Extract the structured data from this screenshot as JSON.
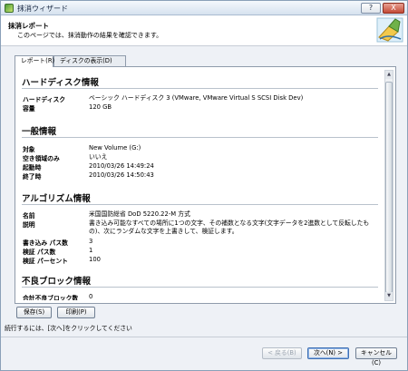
{
  "window": {
    "title": "抹消ウィザード",
    "help_label": "?",
    "close_label": "X"
  },
  "header": {
    "title": "抹消レポート",
    "subtitle": "このページでは、抹消動作の結果を確認できます。"
  },
  "tabs": [
    {
      "label": "レポート(R)",
      "active": true
    },
    {
      "label": "ディスクの表示(D)",
      "active": false
    }
  ],
  "report": {
    "disk": {
      "title": "ハードディスク情報",
      "rows": [
        {
          "label": "ハードディスク",
          "value": "ベーシック ハードディスク 3 (VMware, VMware Virtual S SCSI Disk Dev)"
        },
        {
          "label": "容量",
          "value": "120 GB"
        }
      ]
    },
    "general": {
      "title": "一般情報",
      "rows": [
        {
          "label": "対象",
          "value": "New Volume (G:)"
        },
        {
          "label": "空き領域のみ",
          "value": "いいえ"
        },
        {
          "label": "起動時",
          "value": "2010/03/26 14:49:24"
        },
        {
          "label": "終了時",
          "value": "2010/03/26 14:50:43"
        }
      ]
    },
    "algorithm": {
      "title": "アルゴリズム情報",
      "rows": [
        {
          "label": "名前",
          "value": "米国国防総省 DoD 5220.22-M 方式"
        },
        {
          "label": "説明",
          "value": "書き込み可能なすべての場所に1つの文字、その補数となる文字(文字データを2進数として反転したもの)、次にランダムな文字を上書きして、検証します。"
        },
        {
          "label": "書き込み パス数",
          "value": "3"
        },
        {
          "label": "検証 パス数",
          "value": "1"
        },
        {
          "label": "検証 パーセント",
          "value": "100"
        }
      ]
    },
    "badblocks": {
      "title": "不良ブロック情報",
      "rows": [
        {
          "label": "合計不良ブロック数",
          "value": "0"
        }
      ]
    }
  },
  "actions": {
    "save_label": "保存(S)",
    "print_label": "印刷(P)"
  },
  "status_text": "続行するには、[次へ]をクリックしてください",
  "footer": {
    "back_label": "< 戻る(B)",
    "next_label": "次へ(N) >",
    "cancel_label": "キャンセル(C)"
  }
}
